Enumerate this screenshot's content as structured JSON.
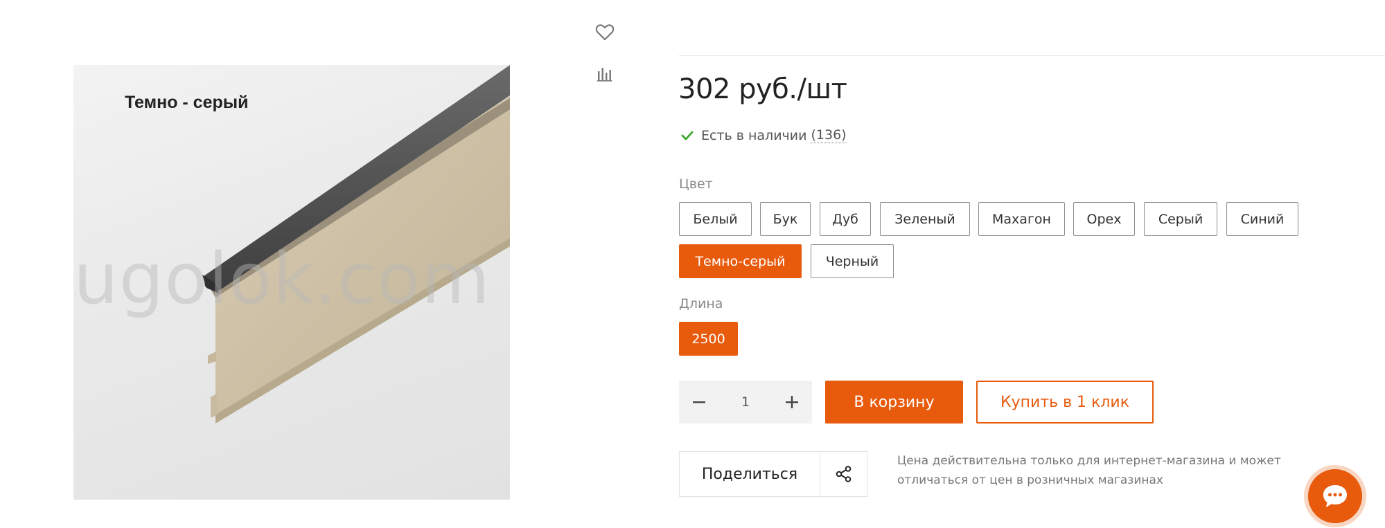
{
  "product": {
    "image_caption": "Темно - серый",
    "watermark": "ugolok.com"
  },
  "icons": {
    "favorite": "heart-icon",
    "compare": "bar-chart-icon",
    "stock_check": "checkmark-icon",
    "minus": "minus-icon",
    "plus": "plus-icon",
    "share": "share-icon",
    "chat": "chat-icon"
  },
  "price": "302 руб./шт",
  "stock": {
    "text": "Есть в наличии",
    "count": "(136)"
  },
  "color": {
    "label": "Цвет",
    "options": [
      "Белый",
      "Бук",
      "Дуб",
      "Зеленый",
      "Махагон",
      "Орех",
      "Серый",
      "Синий",
      "Темно-серый",
      "Черный"
    ],
    "selected": "Темно-серый"
  },
  "length": {
    "label": "Длина",
    "options": [
      "2500"
    ],
    "selected": "2500"
  },
  "quantity": {
    "value": "1"
  },
  "buttons": {
    "cart": "В корзину",
    "one_click": "Купить в 1 клик",
    "share": "Поделиться"
  },
  "note": "Цена действительна только для интернет-магазина и может отличаться от цен в розничных магазинах",
  "colors": {
    "accent": "#e85a0c",
    "stock_check": "#3aa52a"
  }
}
